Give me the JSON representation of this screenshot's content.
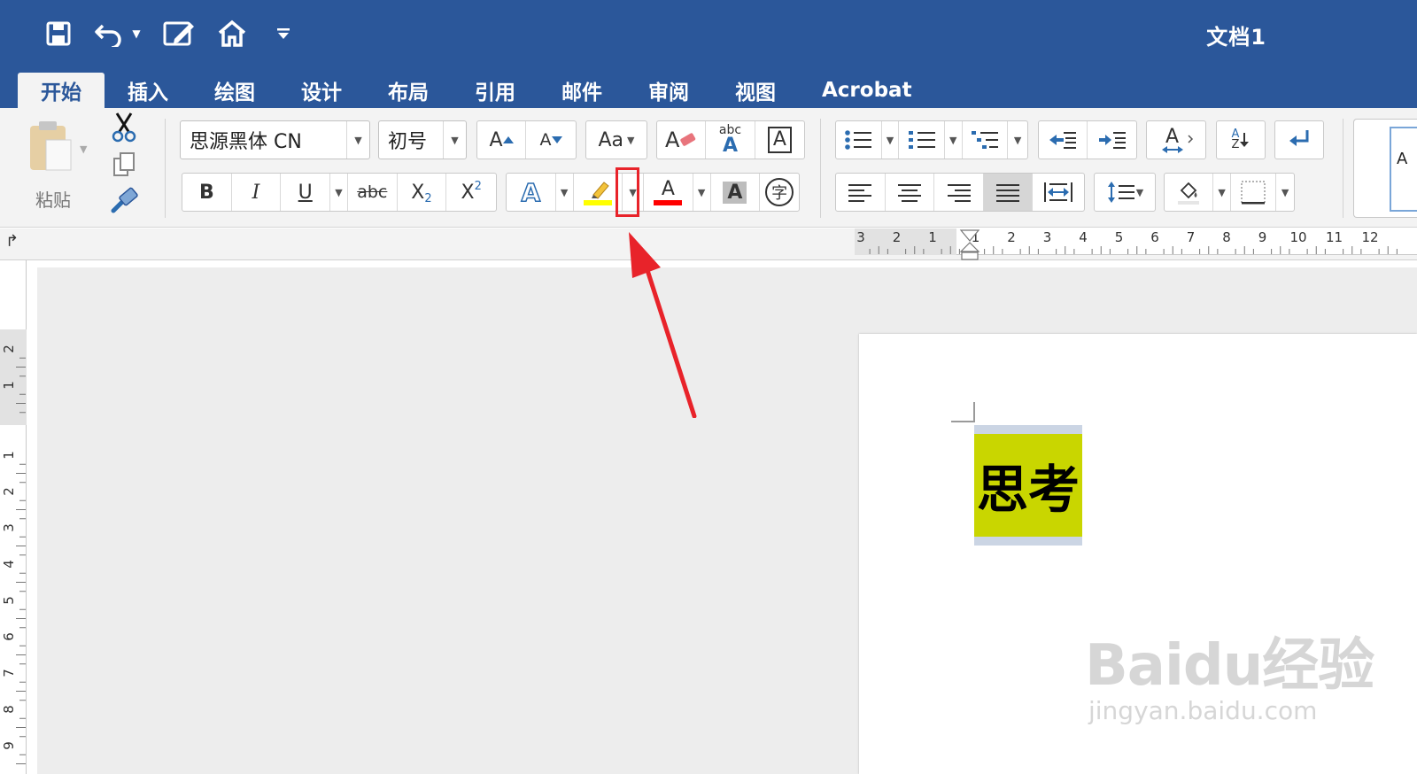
{
  "app": {
    "doc_title": "文档1"
  },
  "tabs": [
    "开始",
    "插入",
    "绘图",
    "设计",
    "布局",
    "引用",
    "邮件",
    "审阅",
    "视图",
    "Acrobat"
  ],
  "ribbon": {
    "paste_label": "粘贴",
    "font_name": "思源黑体 CN",
    "font_size": "初号",
    "bold": "B",
    "italic": "I",
    "underline": "U",
    "strikethrough": "abc",
    "subscript": "X",
    "subscript_mark": "2",
    "superscript": "X",
    "superscript_mark": "2",
    "grow_font": "A",
    "shrink_font": "A",
    "change_case": "Aa",
    "clear_format_glyph": "A",
    "phonetic_small": "abc",
    "phonetic_big": "A",
    "char_border": "A",
    "text_effect": "A",
    "font_color_glyph": "A",
    "char_shading": "A",
    "enclose_char": "字",
    "sort_small_top": "A",
    "sort_small_bottom": "Z",
    "styles_preview": "A"
  },
  "colors": {
    "highlight": "#ffff00",
    "font_color": "#ff0000",
    "accent": "#2b579a",
    "annotation": "#e8232a",
    "doc_highlight": "#c9d600"
  },
  "ruler": {
    "horizontal_ticks": [
      "3",
      "2",
      "1",
      "1",
      "2",
      "3",
      "4",
      "5",
      "6",
      "7",
      "8",
      "9",
      "10",
      "11",
      "12"
    ],
    "vertical_ticks": [
      "2",
      "1",
      "1",
      "2",
      "3",
      "4",
      "5",
      "6",
      "7",
      "8",
      "9"
    ]
  },
  "document": {
    "text": "思考"
  },
  "watermark": {
    "main": "Baidu经验",
    "sub": "jingyan.baidu.com"
  }
}
